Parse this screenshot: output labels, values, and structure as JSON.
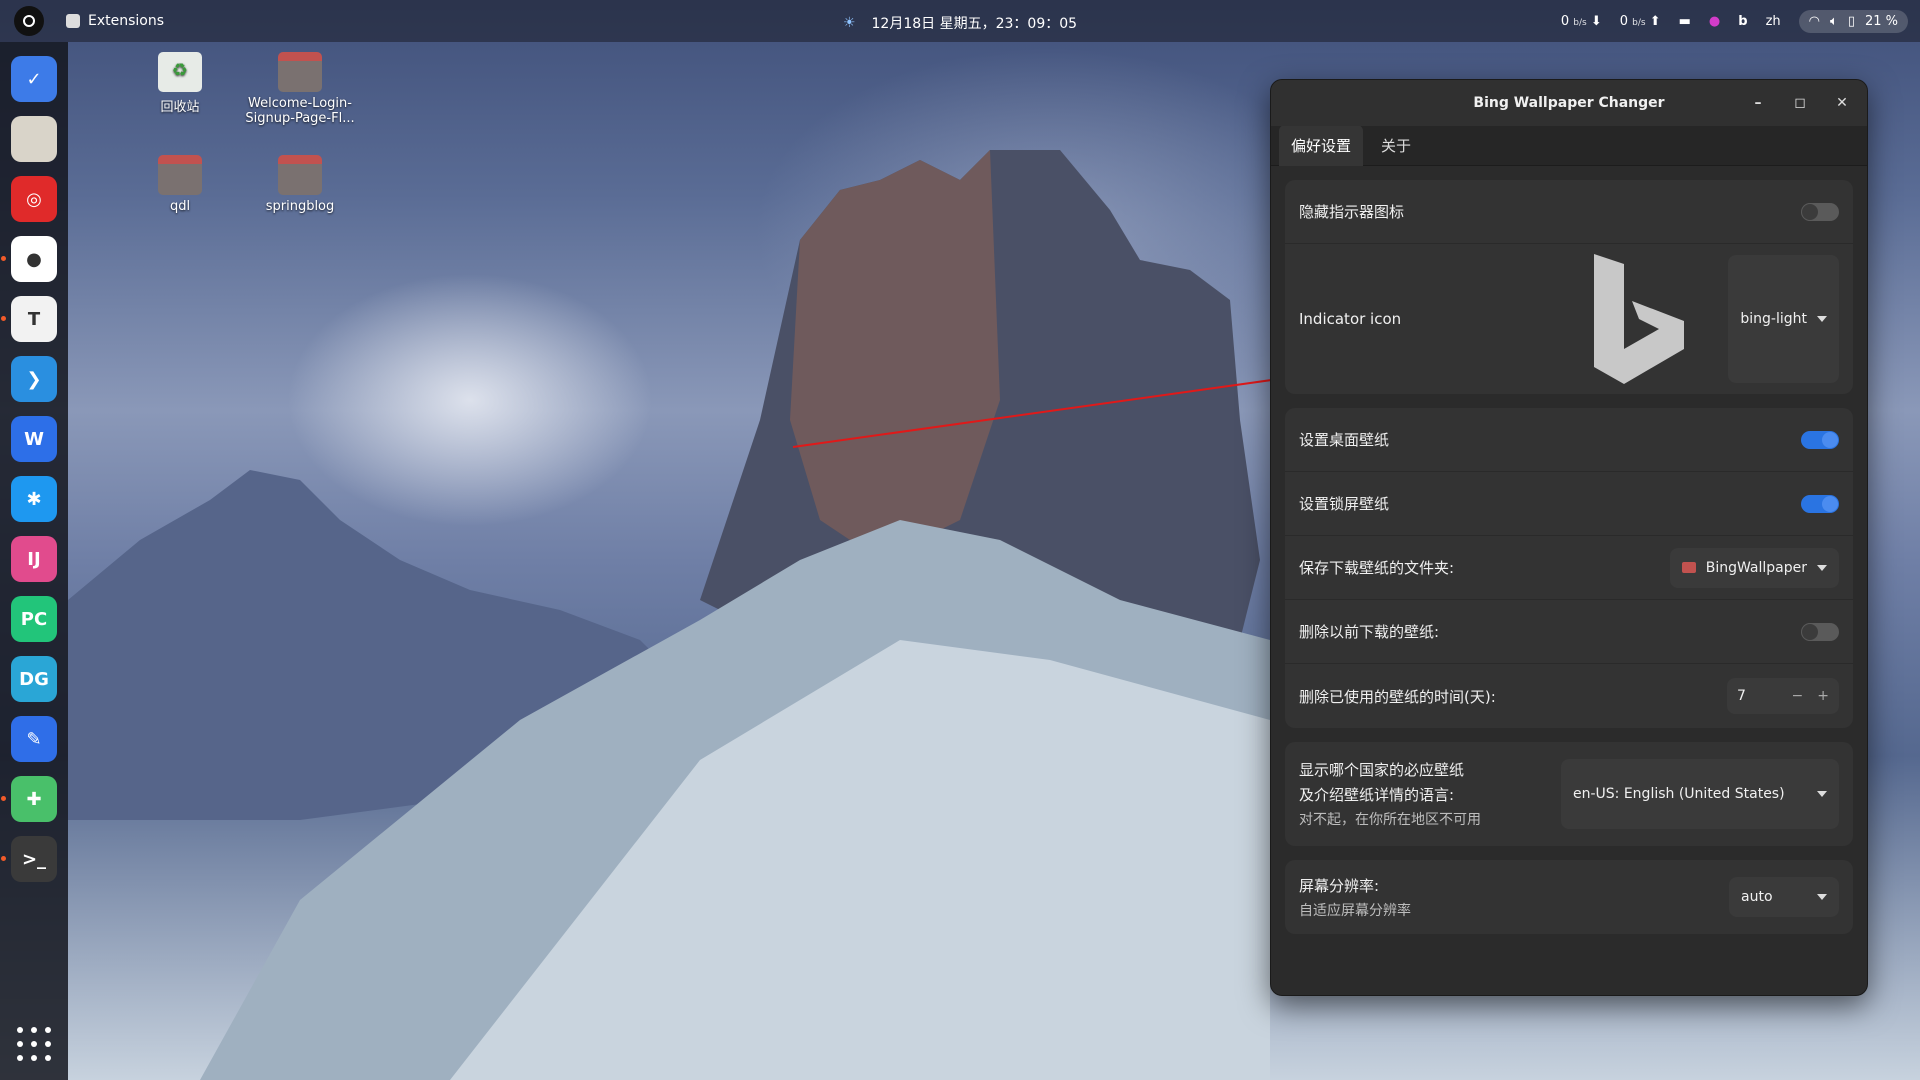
{
  "topbar": {
    "app_name": "Extensions",
    "datetime": "12月18日 星期五，23：09：05",
    "net_down_value": "0",
    "net_down_unit": "b/s",
    "net_up_value": "0",
    "net_up_unit": "b/s",
    "input_method": "zh",
    "battery": "21 %"
  },
  "desktop": {
    "icons": [
      {
        "label": "回收站"
      },
      {
        "label": "Welcome-Login-Signup-Page-Fl..."
      },
      {
        "label": "qdl"
      },
      {
        "label": "springblog"
      }
    ]
  },
  "dock": {
    "apps": [
      {
        "name": "tasks",
        "color": "#3d7be8",
        "glyph": "✓"
      },
      {
        "name": "files",
        "color": "#d9d4c9",
        "glyph": ""
      },
      {
        "name": "netease-music",
        "color": "#e02a2a",
        "glyph": "◎"
      },
      {
        "name": "chrome",
        "color": "#ffffff",
        "glyph": "●"
      },
      {
        "name": "typora",
        "color": "#f2f2f2",
        "glyph": "T"
      },
      {
        "name": "vscode",
        "color": "#2a8fe0",
        "glyph": "❯"
      },
      {
        "name": "wps",
        "color": "#2d6fe8",
        "glyph": "W"
      },
      {
        "name": "star-app",
        "color": "#1e98f0",
        "glyph": "✱"
      },
      {
        "name": "intellij",
        "color": "#e14b8d",
        "glyph": "IJ"
      },
      {
        "name": "pycharm",
        "color": "#22c57a",
        "glyph": "PC"
      },
      {
        "name": "datagrip",
        "color": "#2aa6d6",
        "glyph": "DG"
      },
      {
        "name": "feather",
        "color": "#2f6ee8",
        "glyph": "✎"
      },
      {
        "name": "extensions",
        "color": "#49c06a",
        "glyph": "✚"
      },
      {
        "name": "terminal",
        "color": "#3a3a3a",
        "glyph": ">_"
      }
    ]
  },
  "window": {
    "title": "Bing Wallpaper Changer",
    "tabs": [
      {
        "label": "偏好设置"
      },
      {
        "label": "关于"
      }
    ],
    "hide_indicator": {
      "label": "隐藏指示器图标",
      "on": false
    },
    "indicator_icon": {
      "label": "Indicator icon",
      "value": "bing-light"
    },
    "set_desktop": {
      "label": "设置桌面壁纸",
      "on": true
    },
    "set_lockscreen": {
      "label": "设置锁屏壁纸",
      "on": true
    },
    "download_folder": {
      "label": "保存下载壁纸的文件夹:",
      "value": "BingWallpaper"
    },
    "delete_previous": {
      "label": "删除以前下载的壁纸:",
      "on": false
    },
    "delete_days": {
      "label": "删除已使用的壁纸的时间(天):",
      "value": "7",
      "minus": "−",
      "plus": "+"
    },
    "market": {
      "label_line1": "显示哪个国家的必应壁纸",
      "label_line2": "及介绍壁纸详情的语言:",
      "note": "对不起，在你所在地区不可用",
      "value": "en-US: English (United States)"
    },
    "resolution": {
      "label": "屏幕分辨率:",
      "note": "自适应屏幕分辨率",
      "value": "auto"
    }
  },
  "colors": {
    "accent": "#2a74e2",
    "arrow": "#e01919"
  }
}
